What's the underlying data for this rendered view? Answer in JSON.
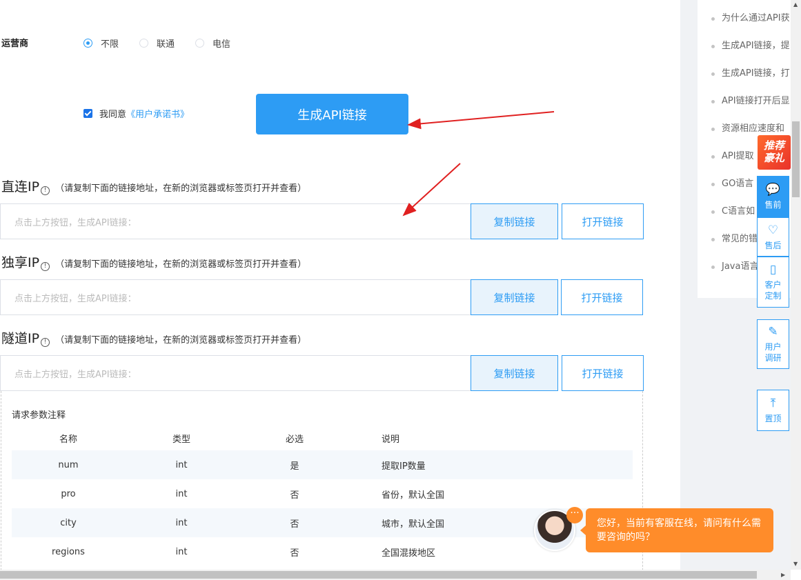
{
  "operator": {
    "label": "运营商",
    "options": [
      {
        "label": "不限",
        "checked": true
      },
      {
        "label": "联通",
        "checked": false
      },
      {
        "label": "电信",
        "checked": false
      }
    ]
  },
  "agreement": {
    "text": "我同意",
    "link": "《用户承诺书》",
    "checked": true
  },
  "generate_button": "生成API链接",
  "sections": [
    {
      "title": "直连IP",
      "note": "（请复制下面的链接地址，在新的浏览器或标签页打开并查看）",
      "placeholder": "点击上方按钮，生成API链接：",
      "copy": "复制链接",
      "open": "打开链接"
    },
    {
      "title": "独享IP",
      "note": "（请复制下面的链接地址，在新的浏览器或标签页打开并查看）",
      "placeholder": "点击上方按钮，生成API链接：",
      "copy": "复制链接",
      "open": "打开链接"
    },
    {
      "title": "隧道IP",
      "note": "（请复制下面的链接地址，在新的浏览器或标签页打开并查看）",
      "placeholder": "点击上方按钮，生成API链接：",
      "copy": "复制链接",
      "open": "打开链接"
    }
  ],
  "params": {
    "title": "请求参数注释",
    "headers": [
      "名称",
      "类型",
      "必选",
      "说明"
    ],
    "rows": [
      [
        "num",
        "int",
        "是",
        "提取IP数量"
      ],
      [
        "pro",
        "int",
        "否",
        "省份，默认全国"
      ],
      [
        "city",
        "int",
        "否",
        "城市，默认全国"
      ],
      [
        "regions",
        "int",
        "否",
        "全国混拨地区"
      ]
    ]
  },
  "right_list": [
    "为什么通过API获",
    "生成API链接，提",
    "生成API链接，打",
    "API链接打开后显",
    "资源相应速度和",
    "API提取",
    "GO语言",
    "C语言如",
    "常见的错",
    "Java语言"
  ],
  "promo": {
    "line1": "推荐",
    "line2": "豪礼"
  },
  "tools": [
    {
      "icon": "💬",
      "label": "售前"
    },
    {
      "icon": "♡",
      "label": "售后"
    },
    {
      "icon": "▯",
      "label": "客户定制"
    },
    {
      "icon": "✎",
      "label": "用户调研"
    },
    {
      "icon": "⤒",
      "label": "置顶"
    }
  ],
  "chat": {
    "dots": "···",
    "message": "您好，当前有客服在线，请问有什么需要咨询的吗？"
  },
  "colors": {
    "accent": "#2d9cf4",
    "chat": "#ff8c2a",
    "arrow": "#e02020"
  }
}
